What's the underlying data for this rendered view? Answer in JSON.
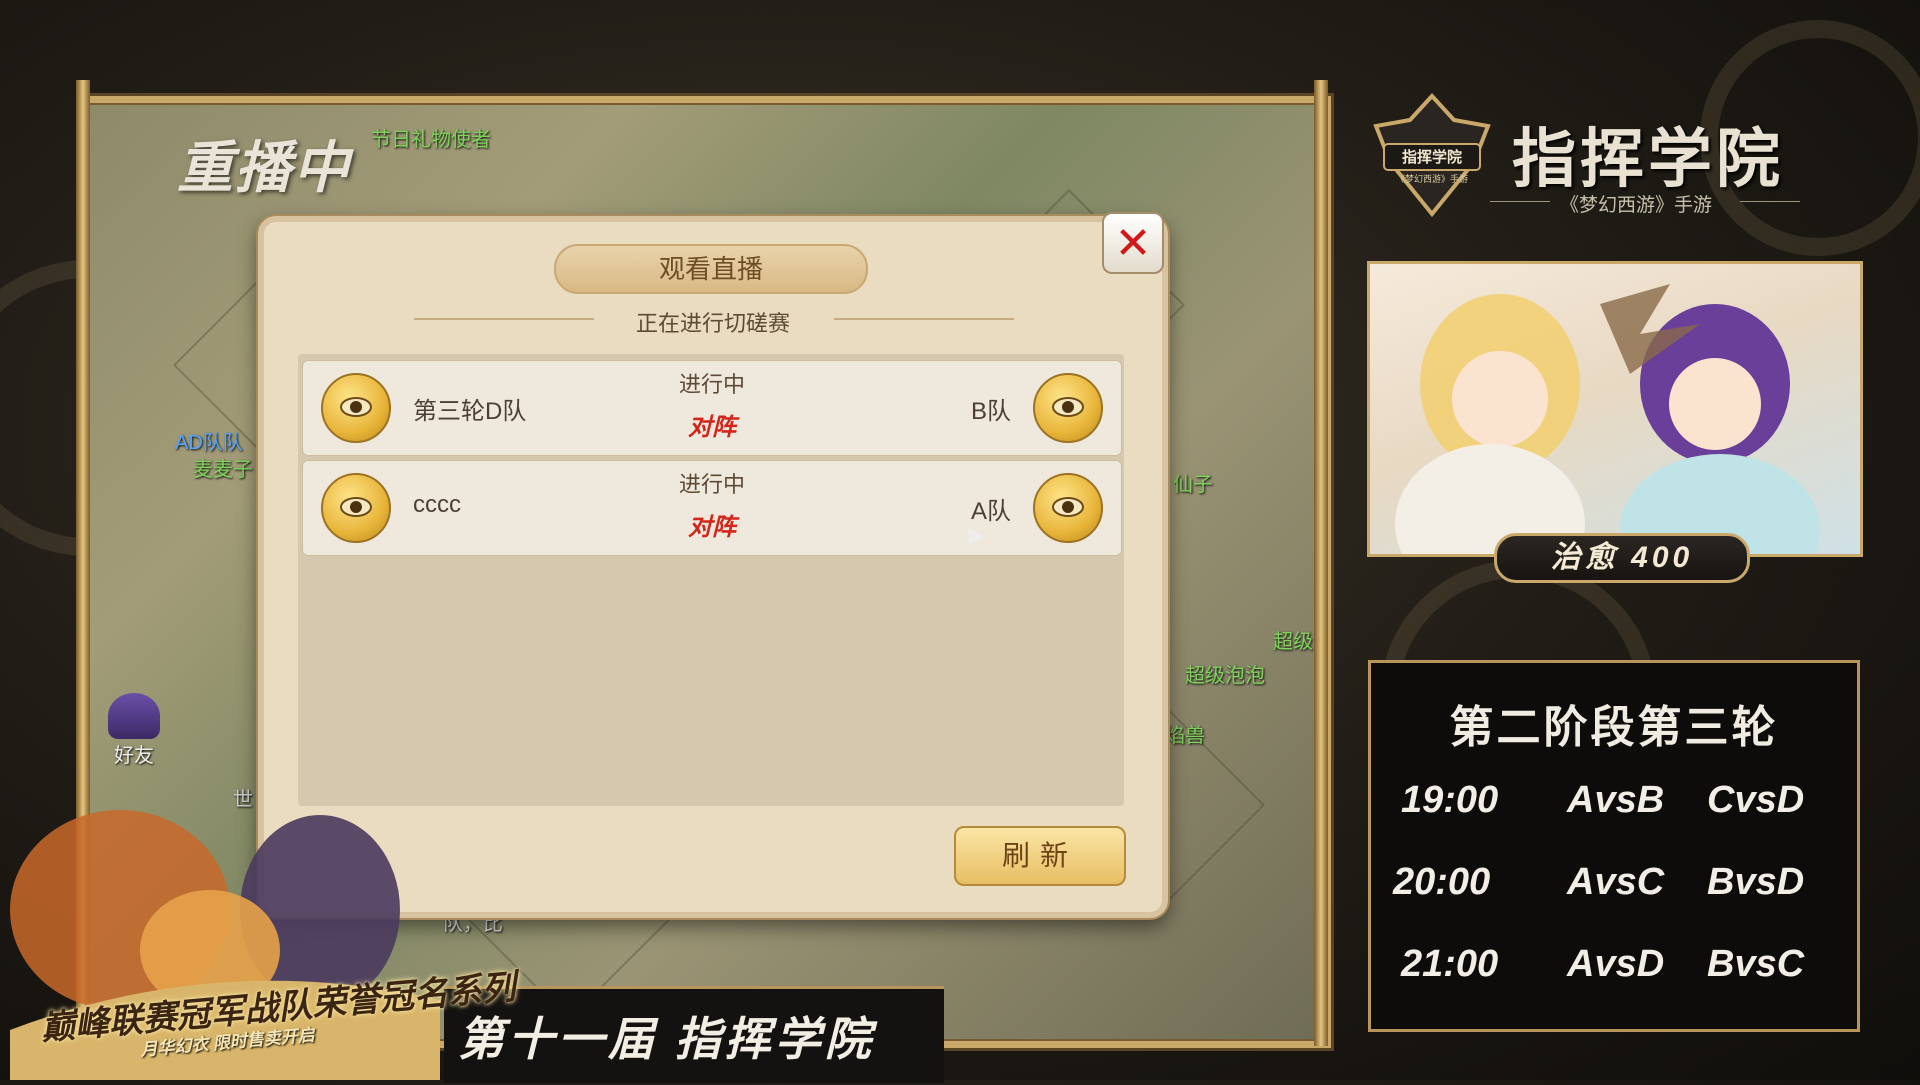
{
  "game": {
    "replay_label": "重播中",
    "npc_top": "节日礼物使者",
    "npc_labels": [
      "AD队队",
      "麦麦子",
      "仙子",
      "超级泡泡",
      "超级",
      "焰兽",
      "世",
      "队，比"
    ],
    "friend_label": "好友"
  },
  "dialog": {
    "title": "观看直播",
    "subtitle": "正在进行切磋赛",
    "close_icon": "✕",
    "rows": [
      {
        "left_team": "第三轮D队",
        "status": "进行中",
        "vs_label": "对阵",
        "right_team": "B队"
      },
      {
        "left_team": "cccc",
        "status": "进行中",
        "vs_label": "对阵",
        "right_team": "A队"
      }
    ],
    "refresh_label": "刷新"
  },
  "brand": {
    "badge_text": "指挥学院",
    "badge_sub": "《梦幻西游》手游",
    "title": "指挥学院",
    "subtitle": "《梦幻西游》手游"
  },
  "hero_card": {
    "heal_label": "治愈",
    "heal_value": "400"
  },
  "schedule": {
    "title": "第二阶段第三轮",
    "rows": [
      {
        "time": "19:00",
        "match1": "AvsB",
        "match2": "CvsD"
      },
      {
        "time": "20:00",
        "match1": "AvsC",
        "match2": "BvsD"
      },
      {
        "time": "21:00",
        "match1": "AvsD",
        "match2": "BvsC"
      }
    ]
  },
  "season_banner": "第十一届  指挥学院",
  "promo": {
    "title": "巅峰联赛冠军战队荣誉冠名系列",
    "subtitle": "月华幻衣 限时售卖开启"
  },
  "colors": {
    "accent_gold": "#c9a86a",
    "vs_red": "#d2261c",
    "close_red": "#d01818"
  }
}
